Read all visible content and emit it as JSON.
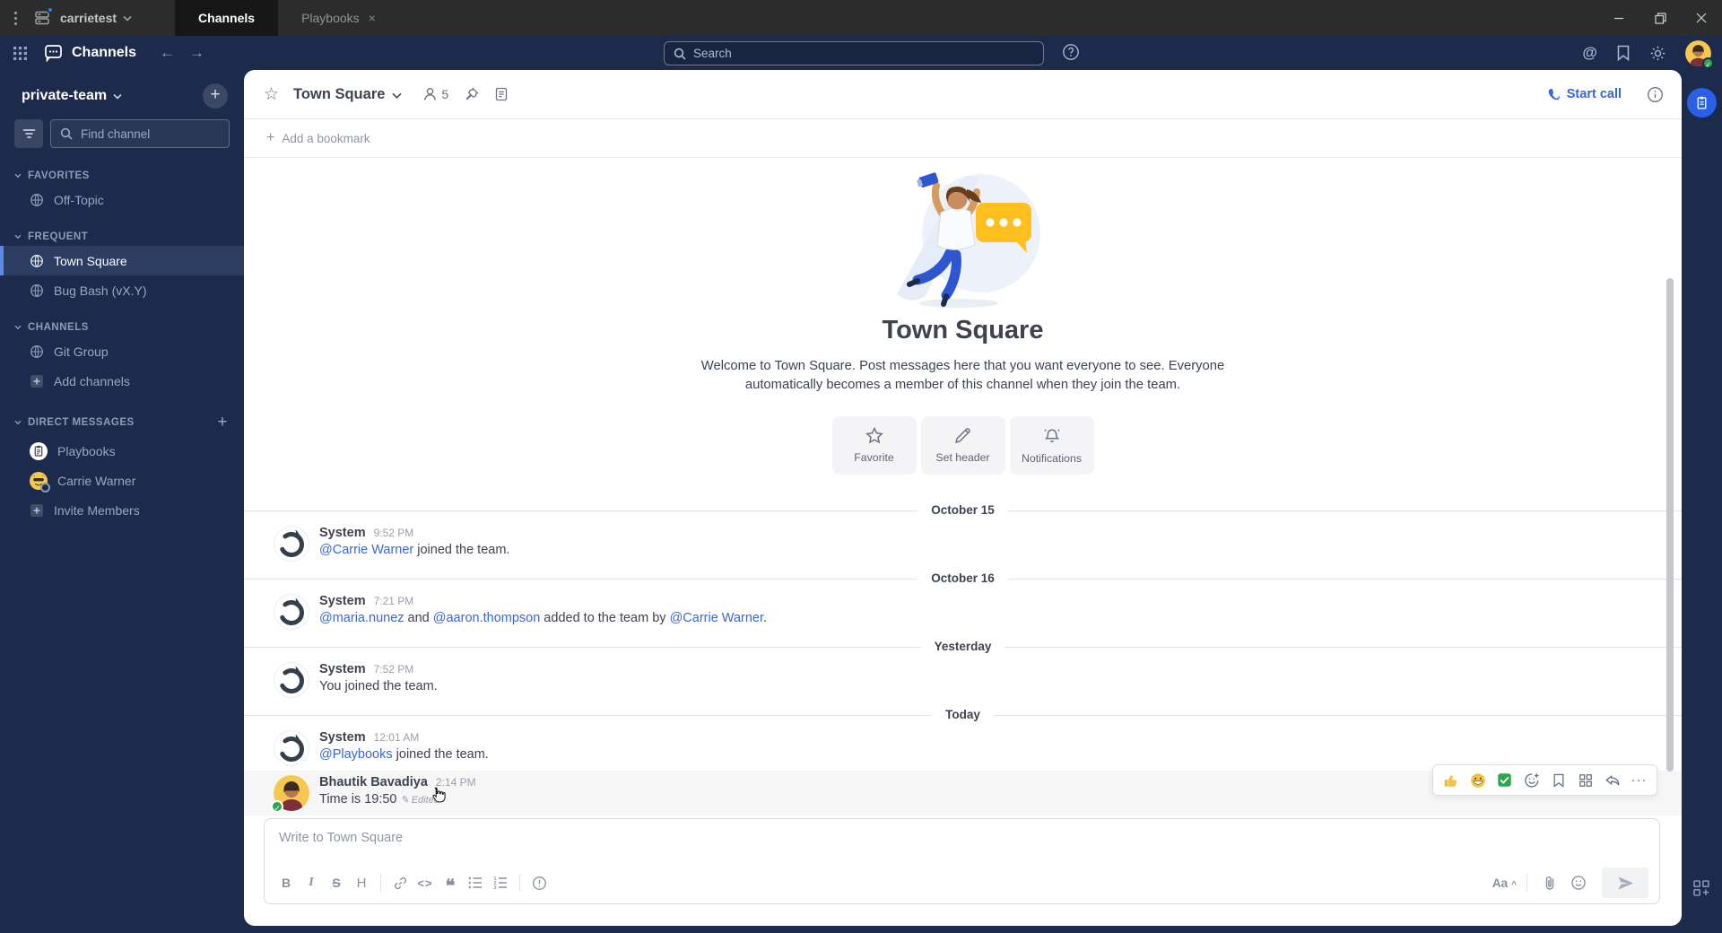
{
  "titlebar": {
    "team_switcher": "carrietest",
    "tabs": {
      "channels": "Channels",
      "playbooks": "Playbooks",
      "close": "×"
    },
    "window_controls": {
      "minimize": "–",
      "close": "×"
    }
  },
  "nav": {
    "product_title": "Channels",
    "back": "←",
    "forward": "→",
    "search_placeholder": "Search",
    "at_symbol": "@"
  },
  "sidebar": {
    "team": "private-team",
    "add_button": "+",
    "find_placeholder": "Find channel",
    "sections": [
      {
        "label": "FAVORITES"
      },
      {
        "label": "FREQUENT"
      },
      {
        "label": "CHANNELS"
      },
      {
        "label": "DIRECT MESSAGES",
        "add": "+"
      }
    ],
    "items": {
      "off_topic": "Off-Topic",
      "town_square": "Town Square",
      "bug_bash": "Bug Bash (vX.Y)",
      "git_group": "Git Group",
      "add_channels": "Add channels",
      "playbooks": "Playbooks",
      "carrie": "Carrie Warner",
      "invite": "Invite Members"
    }
  },
  "channel": {
    "name": "Town Square",
    "member_count": "5",
    "start_call": "Start call",
    "bookmark_plus": "+",
    "add_bookmark": "Add a bookmark"
  },
  "intro": {
    "title": "Town Square",
    "description": "Welcome to Town Square. Post messages here that you want everyone to see. Everyone automatically becomes a member of this channel when they join the team.",
    "buttons": {
      "favorite": "Favorite",
      "set_header": "Set header",
      "notifications": "Notifications"
    }
  },
  "timeline": {
    "dividers": {
      "d1": "October 15",
      "d2": "October 16",
      "d3": "Yesterday",
      "d4": "Today"
    },
    "m1": {
      "author": "System",
      "time": "9:52 PM",
      "link1": "@Carrie Warner",
      "text1": " joined the team."
    },
    "m2": {
      "author": "System",
      "time": "7:21 PM",
      "link1": "@maria.nunez",
      "text1": " and ",
      "link2": "@aaron.thompson",
      "text2": " added to the team by ",
      "link3": "@Carrie Warner",
      "text3": "."
    },
    "m3": {
      "author": "System",
      "time": "7:52 PM",
      "text1": "You joined the team."
    },
    "m4": {
      "author": "System",
      "time": "12:01 AM",
      "link1": "@Playbooks",
      "text1": " joined the team."
    },
    "m5": {
      "author": "Bhautik Bavadiya",
      "time": "2:14 PM",
      "text1": "Time is 19:50",
      "edited_icon": "✎",
      "edited": "Edited"
    }
  },
  "hover_actions": {
    "reaction_icons": [
      "thumbs-up-emoji",
      "grinning-face-emoji",
      "check-mark-button-emoji"
    ],
    "more_label": "···"
  },
  "composer": {
    "placeholder": "Write to Town Square",
    "bold": "B",
    "italic": "I",
    "strike": "S",
    "heading": "H",
    "code": "<>",
    "quote": "❝",
    "format_toggle": "Aa",
    "format_caret": "^"
  },
  "colors": {
    "navy": "#1C2B4C",
    "titlebar": "#2C2C2C",
    "accent_blue": "#2A5FE8",
    "link_blue": "#3A67D6",
    "selected_bar": "#5D89EA",
    "bubble_yellow": "#FFBF1F",
    "online_green": "#2EA44C",
    "text_dark": "#3F4350",
    "text_gray": "#8F95A3"
  }
}
